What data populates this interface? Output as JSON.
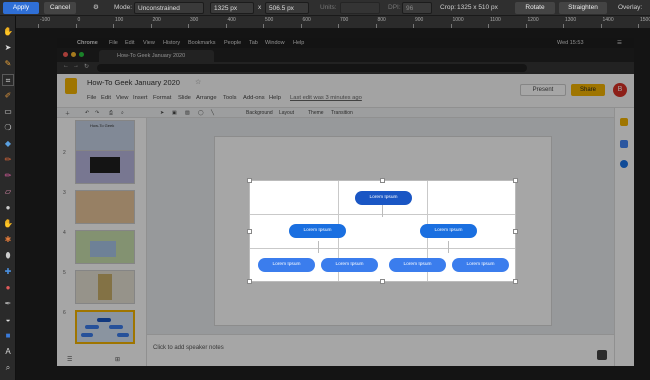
{
  "crop_toolbar": {
    "apply": "Apply",
    "cancel": "Cancel",
    "mode_label": "Mode:",
    "mode_value": "Unconstrained",
    "width": "1325 px",
    "x_sep": "x",
    "height": "506.5 px",
    "units_label": "Units:",
    "dpi_label": "DPI:",
    "dpi_value": "96",
    "crop_label": "Crop:",
    "crop_value": "1325 x 510 px",
    "rotate": "Rotate",
    "straighten": "Straighten",
    "overlay": "Overlay:",
    "accent": "#2f6fd6"
  },
  "ruler": {
    "ticks": [
      "-100",
      "0",
      "100",
      "200",
      "300",
      "400",
      "500",
      "600",
      "700",
      "800",
      "900",
      "1000",
      "1100",
      "1200",
      "1300",
      "1400",
      "1500"
    ]
  },
  "menubar": {
    "app": "Chrome",
    "items": [
      "File",
      "Edit",
      "View",
      "History",
      "Bookmarks",
      "People",
      "Tab",
      "Window",
      "Help"
    ],
    "clock": "Wed 15:53"
  },
  "tab": {
    "title": "How-To Geek January 2020"
  },
  "slides": {
    "title": "How-To Geek January 2020",
    "menus": [
      "File",
      "Edit",
      "View",
      "Insert",
      "Format",
      "Slide",
      "Arrange",
      "Tools",
      "Add-ons",
      "Help"
    ],
    "last_edit": "Last edit was 3 minutes ago",
    "present": "Present",
    "share": "Share",
    "avatar": "B",
    "toolbar": [
      "Background",
      "Layout",
      "Theme",
      "Transition"
    ],
    "notes": "Click to add speaker notes",
    "thumb_numbers": [
      "",
      "2",
      "3",
      "4",
      "5",
      "6"
    ],
    "thumb1_text": "How-To Geek"
  },
  "diagram": {
    "top": "Lorem Ipsum",
    "mid_left": "Lorem Ipsum",
    "mid_right": "Lorem Ipsum",
    "bottom": [
      "Lorem Ipsum",
      "Lorem Ipsum",
      "Lorem Ipsum",
      "Lorem Ipsum"
    ],
    "dark_blue": "#1a56c4",
    "blue": "#3b7ded"
  }
}
